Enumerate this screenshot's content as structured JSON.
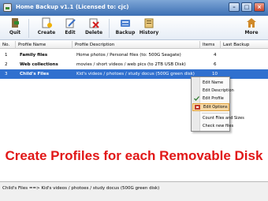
{
  "window": {
    "title": "Home Backup v1.1  (Licensed to: cjc)"
  },
  "toolbar": {
    "quit": "Quit",
    "create": "Create",
    "edit": "Edit",
    "delete": "Delete",
    "backup": "Backup",
    "history": "History",
    "more": "More"
  },
  "list": {
    "columns": [
      "No.",
      "Profile Name",
      "Profile Description",
      "Items",
      "Last Backup"
    ],
    "rows": [
      {
        "no": "1",
        "name": "Family files",
        "description": "Home photos / Personal files (to: 500G Seagate)",
        "items": "4",
        "last_backup": ""
      },
      {
        "no": "2",
        "name": "Web collections",
        "description": "movies / short videos / web pics (to 2TB USB Disk)",
        "items": "6",
        "last_backup": ""
      },
      {
        "no": "3",
        "name": "Child's Files",
        "description": "Kid's videos / photoes / study docus (500G green disk)",
        "items": "10",
        "last_backup": ""
      }
    ]
  },
  "context_menu": {
    "items": [
      "Edit Name",
      "Edit Description",
      "Edit Profile",
      "Edit Options",
      "Count Files and Sizes",
      "Check new files"
    ],
    "highlighted": "Edit Options"
  },
  "caption": "Create Profiles for each Removable Disk",
  "status": {
    "text": "Child's Files  ==>  Kid's videos / photoes / study docus (500G green disk)"
  },
  "colors": {
    "selection": "#3070cf",
    "caption": "#e11717",
    "menu_highlight": "#f7d9a5"
  }
}
